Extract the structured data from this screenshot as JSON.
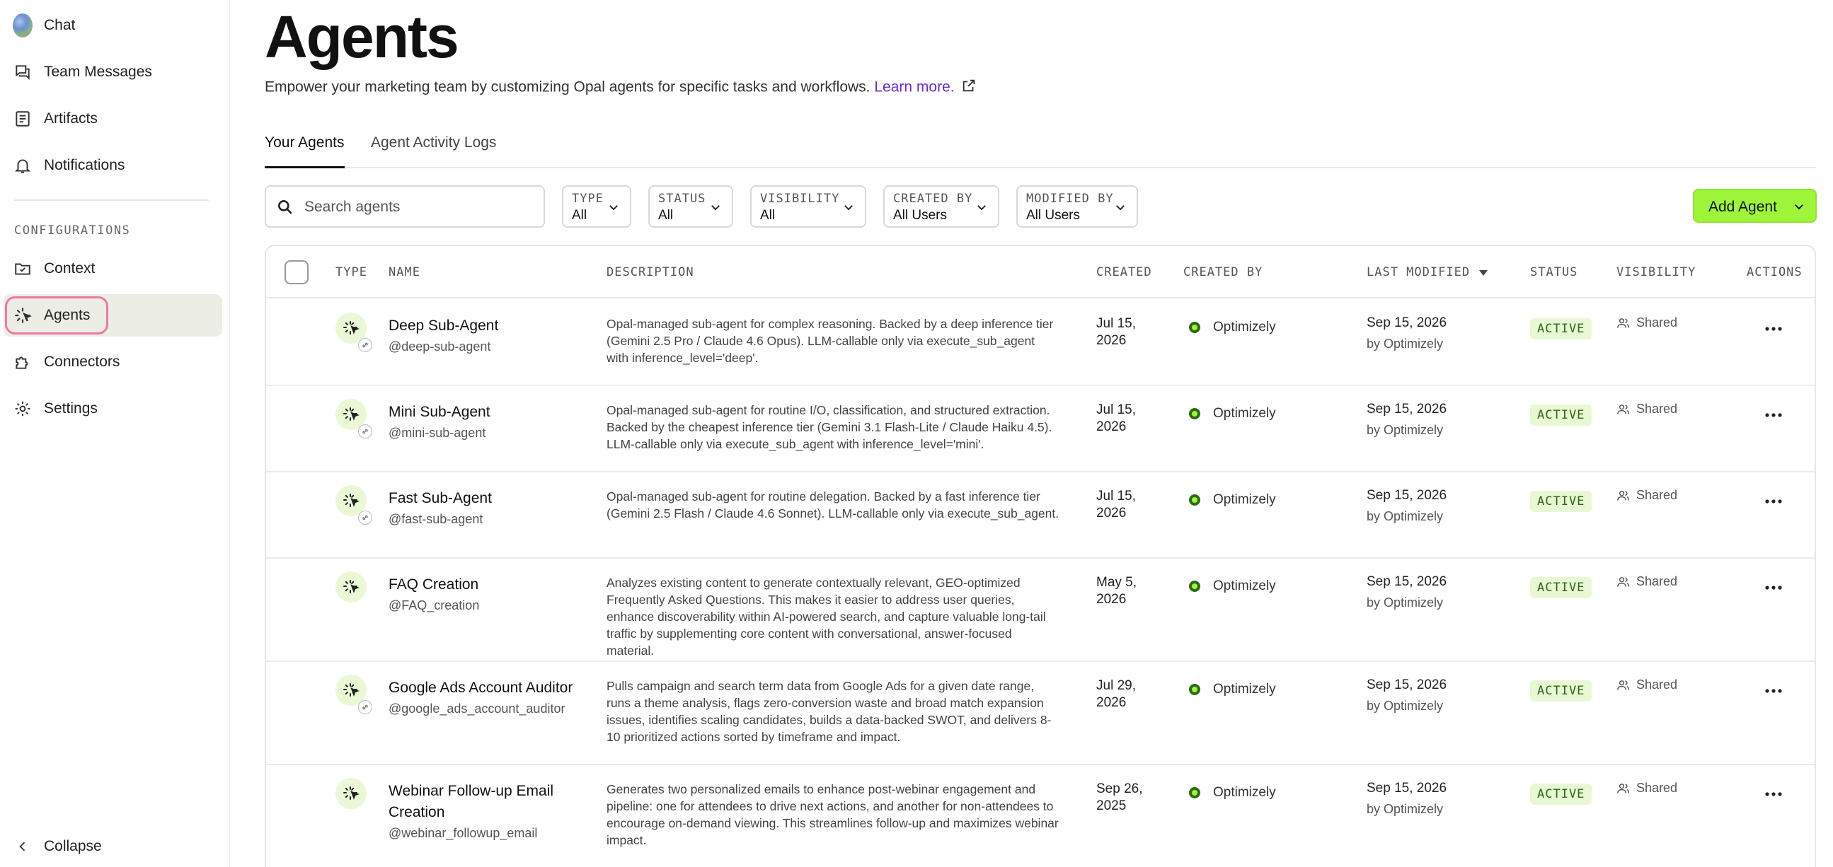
{
  "sidebar": {
    "items": [
      {
        "label": "Chat",
        "icon": "globe-avatar-icon"
      },
      {
        "label": "Team Messages",
        "icon": "messages-icon"
      },
      {
        "label": "Artifacts",
        "icon": "artifacts-icon"
      },
      {
        "label": "Notifications",
        "icon": "bell-icon"
      }
    ],
    "section_label": "CONFIGURATIONS",
    "config_items": [
      {
        "label": "Context",
        "icon": "folder-check-icon"
      },
      {
        "label": "Agents",
        "icon": "agent-sparkle-icon",
        "active": true
      },
      {
        "label": "Connectors",
        "icon": "puzzle-icon"
      },
      {
        "label": "Settings",
        "icon": "gear-icon"
      }
    ],
    "collapse_label": "Collapse"
  },
  "header": {
    "title": "Agents",
    "subtitle": "Empower your marketing team by customizing Opal agents for specific tasks and workflows.",
    "learn_more": "Learn more."
  },
  "tabs": [
    {
      "label": "Your Agents",
      "active": true
    },
    {
      "label": "Agent Activity Logs",
      "active": false
    }
  ],
  "search": {
    "placeholder": "Search agents",
    "value": ""
  },
  "filters": [
    {
      "label": "TYPE",
      "value": "All"
    },
    {
      "label": "STATUS",
      "value": "All"
    },
    {
      "label": "VISIBILITY",
      "value": "All"
    },
    {
      "label": "CREATED BY",
      "value": "All Users"
    },
    {
      "label": "MODIFIED BY",
      "value": "All Users"
    }
  ],
  "add_agent_label": "Add Agent",
  "table": {
    "columns": [
      "TYPE",
      "NAME",
      "DESCRIPTION",
      "CREATED",
      "CREATED BY",
      "LAST MODIFIED",
      "STATUS",
      "VISIBILITY",
      "ACTIONS"
    ],
    "sorted_column": "LAST MODIFIED",
    "rows": [
      {
        "name": "Deep Sub-Agent",
        "handle": "@deep-sub-agent",
        "description": "Opal-managed sub-agent for complex reasoning. Backed by a deep inference tier (Gemini 2.5 Pro / Claude 4.6 Opus). LLM-callable only via execute_sub_agent with inference_level='deep'.",
        "created": "Jul 15, 2026",
        "created_by": "Optimizely",
        "modified_date": "Sep 15, 2026",
        "modified_by": "by Optimizely",
        "status": "ACTIVE",
        "visibility": "Shared",
        "linked": true
      },
      {
        "name": "Mini Sub-Agent",
        "handle": "@mini-sub-agent",
        "description": "Opal-managed sub-agent for routine I/O, classification, and structured extraction. Backed by the cheapest inference tier (Gemini 3.1 Flash-Lite / Claude Haiku 4.5). LLM-callable only via execute_sub_agent with inference_level='mini'.",
        "created": "Jul 15, 2026",
        "created_by": "Optimizely",
        "modified_date": "Sep 15, 2026",
        "modified_by": "by Optimizely",
        "status": "ACTIVE",
        "visibility": "Shared",
        "linked": true
      },
      {
        "name": "Fast Sub-Agent",
        "handle": "@fast-sub-agent",
        "description": "Opal-managed sub-agent for routine delegation. Backed by a fast inference tier (Gemini 2.5 Flash / Claude 4.6 Sonnet). LLM-callable only via execute_sub_agent.",
        "created": "Jul 15, 2026",
        "created_by": "Optimizely",
        "modified_date": "Sep 15, 2026",
        "modified_by": "by Optimizely",
        "status": "ACTIVE",
        "visibility": "Shared",
        "linked": true
      },
      {
        "name": "FAQ Creation",
        "handle": "@FAQ_creation",
        "description": "Analyzes existing content to generate contextually relevant, GEO-optimized Frequently Asked Questions. This makes it easier to address user queries, enhance discoverability within AI-powered search, and capture valuable long-tail traffic by supplementing core content with conversational, answer-focused material.",
        "created": "May 5, 2026",
        "created_by": "Optimizely",
        "modified_date": "Sep 15, 2026",
        "modified_by": "by Optimizely",
        "status": "ACTIVE",
        "visibility": "Shared",
        "linked": false
      },
      {
        "name": "Google Ads Account Auditor",
        "handle": "@google_ads_account_auditor",
        "description": "Pulls campaign and search term data from Google Ads for a given date range, runs a theme analysis, flags zero-conversion waste and broad match expansion issues, identifies scaling candidates, builds a data-backed SWOT, and delivers 8-10 prioritized actions sorted by timeframe and impact.",
        "created": "Jul 29, 2026",
        "created_by": "Optimizely",
        "modified_date": "Sep 15, 2026",
        "modified_by": "by Optimizely",
        "status": "ACTIVE",
        "visibility": "Shared",
        "linked": true
      },
      {
        "name": "Webinar Follow-up Email Creation",
        "handle": "@webinar_followup_email",
        "description": "Generates two personalized emails to enhance post-webinar engagement and pipeline: one for attendees to drive next actions, and another for non-attendees to encourage on-demand viewing. This streamlines follow-up and maximizes webinar impact.",
        "created": "Sep 26, 2025",
        "created_by": "Optimizely",
        "modified_date": "Sep 15, 2026",
        "modified_by": "by Optimizely",
        "status": "ACTIVE",
        "visibility": "Shared",
        "linked": false
      }
    ]
  },
  "colors": {
    "accent_green": "#9ef53a",
    "status_bg": "#e8f8d4",
    "status_text": "#2c6a10",
    "active_nav_bg": "#ecede4",
    "active_ring": "#ee7aa6",
    "link_purple": "#6b2bd6"
  }
}
